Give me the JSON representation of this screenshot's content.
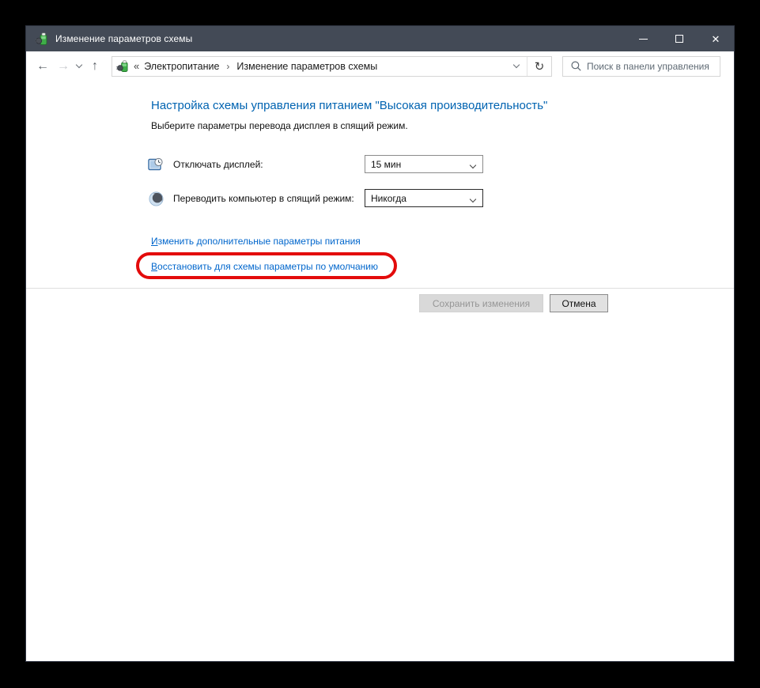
{
  "window": {
    "title": "Изменение параметров схемы"
  },
  "navbar": {
    "breadcrumb": {
      "prefix": "«",
      "item1": "Электропитание",
      "separator": "›",
      "item2": "Изменение параметров схемы"
    },
    "search_placeholder": "Поиск в панели управления"
  },
  "main": {
    "heading": "Настройка схемы управления питанием \"Высокая производительность\"",
    "subheading": "Выберите параметры перевода дисплея в спящий режим.",
    "settings": [
      {
        "icon": "display-timeout-icon",
        "label": "Отключать дисплей:",
        "value": "15 мин"
      },
      {
        "icon": "sleep-icon",
        "label": "Переводить компьютер в спящий режим:",
        "value": "Никогда"
      }
    ],
    "links": [
      {
        "first": "И",
        "rest": "зменить дополнительные параметры питания"
      },
      {
        "first": "В",
        "rest": "осстановить для схемы параметры по умолчанию",
        "annotated": true
      }
    ],
    "save_button": "Сохранить изменения",
    "cancel_button": "Отмена"
  },
  "icons": {
    "back": "←",
    "forward": "→",
    "up": "↑",
    "refresh": "↻",
    "close": "✕"
  },
  "colors": {
    "titlebar": "#434a56",
    "heading_blue": "#0063b1",
    "link_blue": "#0066cc",
    "annotation_red": "#e30b0b"
  }
}
